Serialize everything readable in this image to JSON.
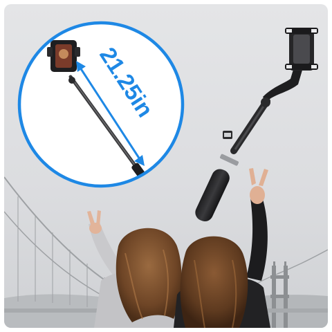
{
  "product_photo": {
    "dimension_label": "21.25in",
    "accent_color": "#1e88e5",
    "icons": [
      "selfie-stick-tripod-icon",
      "phone-holder-icon",
      "double-arrow-icon"
    ]
  }
}
